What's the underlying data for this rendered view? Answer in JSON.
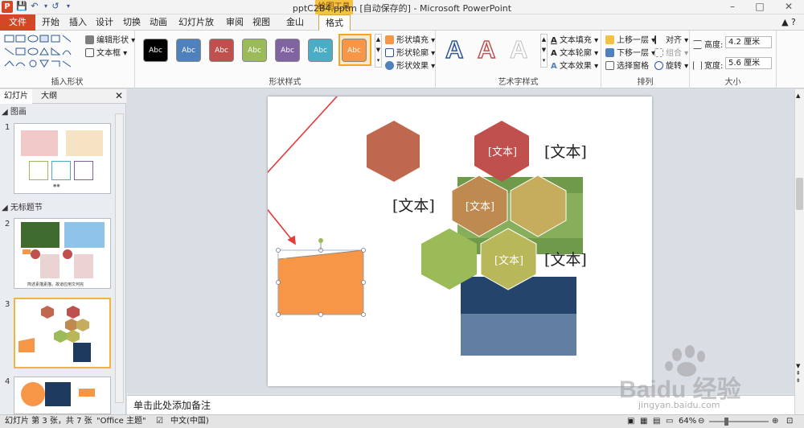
{
  "window": {
    "title": "pptC2B4.pptm [自动保存的] - Microsoft PowerPoint",
    "context_tab_group": "绘图工具",
    "app_icon_letter": "P"
  },
  "tabs": [
    "文件",
    "开始",
    "插入",
    "设计",
    "切换",
    "动画",
    "幻灯片放映",
    "审阅",
    "视图",
    "金山PDF",
    "格式"
  ],
  "ribbon": {
    "insert_shapes": {
      "label": "插入形状",
      "edit_shape": "编辑形状",
      "text_box": "文本框"
    },
    "shape_styles": {
      "label": "形状样式",
      "swatch_text": "Abc",
      "swatch_colors": [
        "#000000",
        "#4f81bd",
        "#c0504d",
        "#9bbb59",
        "#8064a2",
        "#4bacc6",
        "#f79646"
      ],
      "fill": "形状填充",
      "outline": "形状轮廓",
      "effects": "形状效果"
    },
    "wordart_styles": {
      "label": "艺术字样式",
      "sample": "A",
      "text_fill": "文本填充",
      "text_outline": "文本轮廓",
      "text_effects": "文本效果"
    },
    "arrange": {
      "label": "排列",
      "bring_forward": "上移一层",
      "send_backward": "下移一层",
      "selection_pane": "选择窗格",
      "align": "对齐",
      "group": "组合",
      "rotate": "旋转"
    },
    "size": {
      "label": "大小",
      "height_label": "高度:",
      "height_value": "4.2 厘米",
      "width_label": "宽度:",
      "width_value": "5.6 厘米"
    }
  },
  "left_pane": {
    "tabs": [
      "幻灯片",
      "大纲"
    ],
    "section1": "图画",
    "section2": "无标题节",
    "slide_numbers": [
      "1",
      "2",
      "3",
      "4"
    ],
    "slide2_caption": "简述素描素描，故道应用文何完",
    "slide1_caption": "◉◉"
  },
  "slide": {
    "hex_text": "[文本]",
    "free_text": "[文本]",
    "colors": {
      "hex_brown": "#c0684f",
      "hex_red": "#c0504d",
      "hex_tan": "#bf8a4f",
      "hex_khaki": "#c6ad5d",
      "hex_green": "#9bbb59",
      "hex_olive": "#b8b85a",
      "orange_shape": "#f79646",
      "arrow": "#e5393a"
    }
  },
  "notes": {
    "placeholder": "单击此处添加备注"
  },
  "status": {
    "slide_info": "幻灯片 第 3 张，共 7 张",
    "theme": "\"Office 主题\"",
    "language": "中文(中国)",
    "zoom": "64%"
  },
  "watermark": {
    "text": "Baidu 经验",
    "url": "jingyan.baidu.com"
  }
}
